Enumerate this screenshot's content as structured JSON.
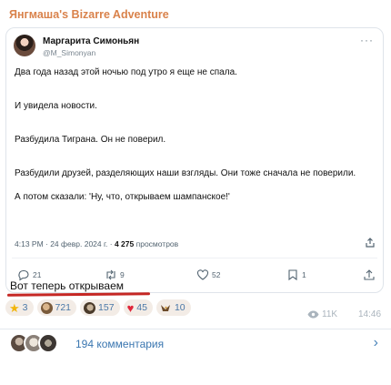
{
  "channel": {
    "title": "Янгмаша's Bizarre Adventure"
  },
  "tweet": {
    "author_name": "Маргарита Симоньян",
    "author_handle": "@M_Simonyan",
    "paragraphs": [
      "Два года назад этой ночью под утро я еще не спала.",
      "И увидела новости.",
      "Разбудила Тиграна. Он не поверил.",
      "Разбудили друзей, разделяющих наши взгляды. Они тоже сначала не поверили.",
      "А потом сказали: 'Ну, что, открываем шампанское!'"
    ],
    "time_date": "4:13 PM · 24 февр. 2024 г. · ",
    "views_count": "4 275",
    "views_label": " просмотров",
    "replies": "21",
    "retweets": "9",
    "likes": "52",
    "bookmarks": "1"
  },
  "message": {
    "text": "Вот теперь открываем"
  },
  "reactions": [
    {
      "emoji": "star",
      "count": "3"
    },
    {
      "emoji": "face-1",
      "count": "721"
    },
    {
      "emoji": "face-2",
      "count": "157"
    },
    {
      "emoji": "heart",
      "count": "45"
    },
    {
      "emoji": "bird",
      "count": "10"
    }
  ],
  "post_meta": {
    "views": "11K",
    "time": "14:46"
  },
  "comments": {
    "label": "194 комментария"
  },
  "colors": {
    "accent": "#3a76b0",
    "channel_title": "#d9824b",
    "underline": "#c52724"
  }
}
